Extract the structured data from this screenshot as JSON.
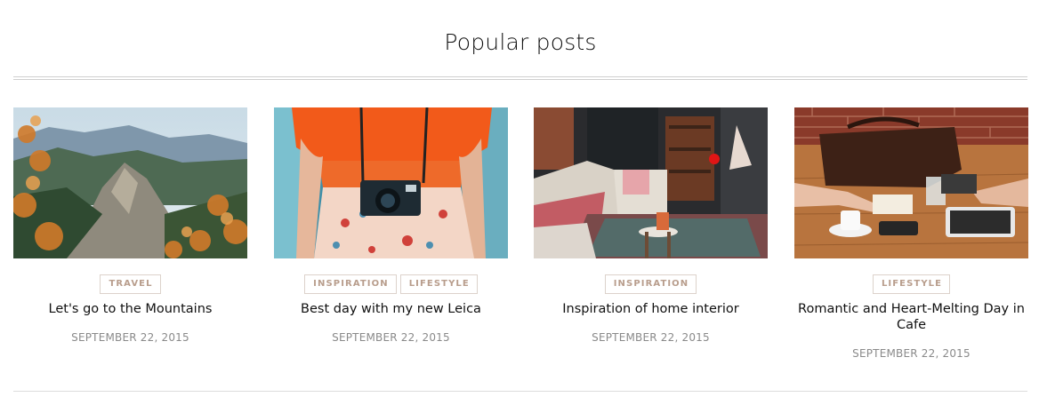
{
  "section": {
    "title": "Popular posts"
  },
  "posts": [
    {
      "title": "Let's go to the Mountains",
      "tags": [
        "TRAVEL"
      ],
      "date": "SEPTEMBER 22, 2015",
      "image": "mountain-landscape-image"
    },
    {
      "title": "Best day with my new Leica",
      "tags": [
        "INSPIRATION",
        "LIFESTYLE"
      ],
      "date": "SEPTEMBER 22, 2015",
      "image": "camera-woman-image"
    },
    {
      "title": "Inspiration of home interior",
      "tags": [
        "INSPIRATION"
      ],
      "date": "SEPTEMBER 22, 2015",
      "image": "living-room-image"
    },
    {
      "title": "Romantic and Heart-Melting Day in Cafe",
      "tags": [
        "LIFESTYLE"
      ],
      "date": "SEPTEMBER 22, 2015",
      "image": "cafe-table-image"
    }
  ],
  "colors": {
    "tag_text": "#b89d8c",
    "tag_border": "#dcd2cb",
    "date_text": "#8a8a8a",
    "rule": "#cfcfcf"
  }
}
